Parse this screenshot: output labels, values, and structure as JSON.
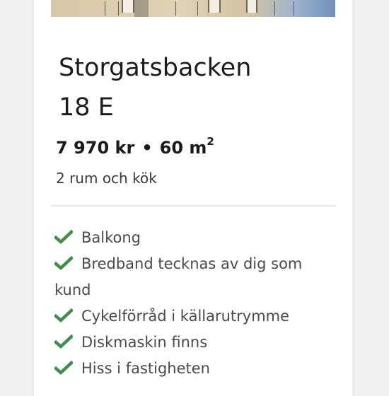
{
  "listing": {
    "street": "Storgatsbacken",
    "number": "18 E",
    "rent": "7 970 kr",
    "separator": "•",
    "area": "60 m",
    "area_unit_sup": "2",
    "rooms": "2 rum och kök",
    "amenities": [
      "Balkong",
      "Bredband tecknas av dig som kund",
      "Cykelförråd i källarutrymme",
      "Diskmaskin finns",
      "Hiss i fastigheten"
    ]
  },
  "colors": {
    "check": "#3f8f4a",
    "text": "#1c1c1c"
  },
  "icons": {
    "amenity": "checkmark-icon"
  }
}
